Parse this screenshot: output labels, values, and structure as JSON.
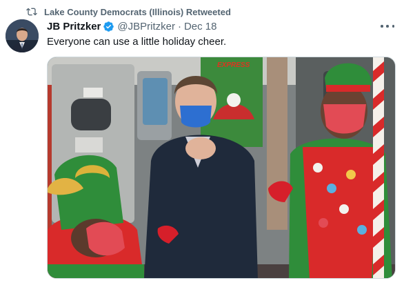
{
  "retweet": {
    "icon": "retweet-icon",
    "text": "Lake County Democrats (Illinois) Retweeted"
  },
  "author": {
    "name": "JB Pritzker",
    "verified_icon": "verified-badge-icon",
    "handle": "@JBPritzker",
    "separator": "·",
    "date": "Dec 18"
  },
  "tweet": {
    "text": "Everyone can use a little holiday cheer."
  },
  "more_icon": "more-options-icon",
  "media": {
    "train_sign": "EXPRESS"
  },
  "colors": {
    "text_primary": "#0f1419",
    "text_secondary": "#536471",
    "verified_blue": "#1d9bf0",
    "border": "#cfd9de"
  }
}
